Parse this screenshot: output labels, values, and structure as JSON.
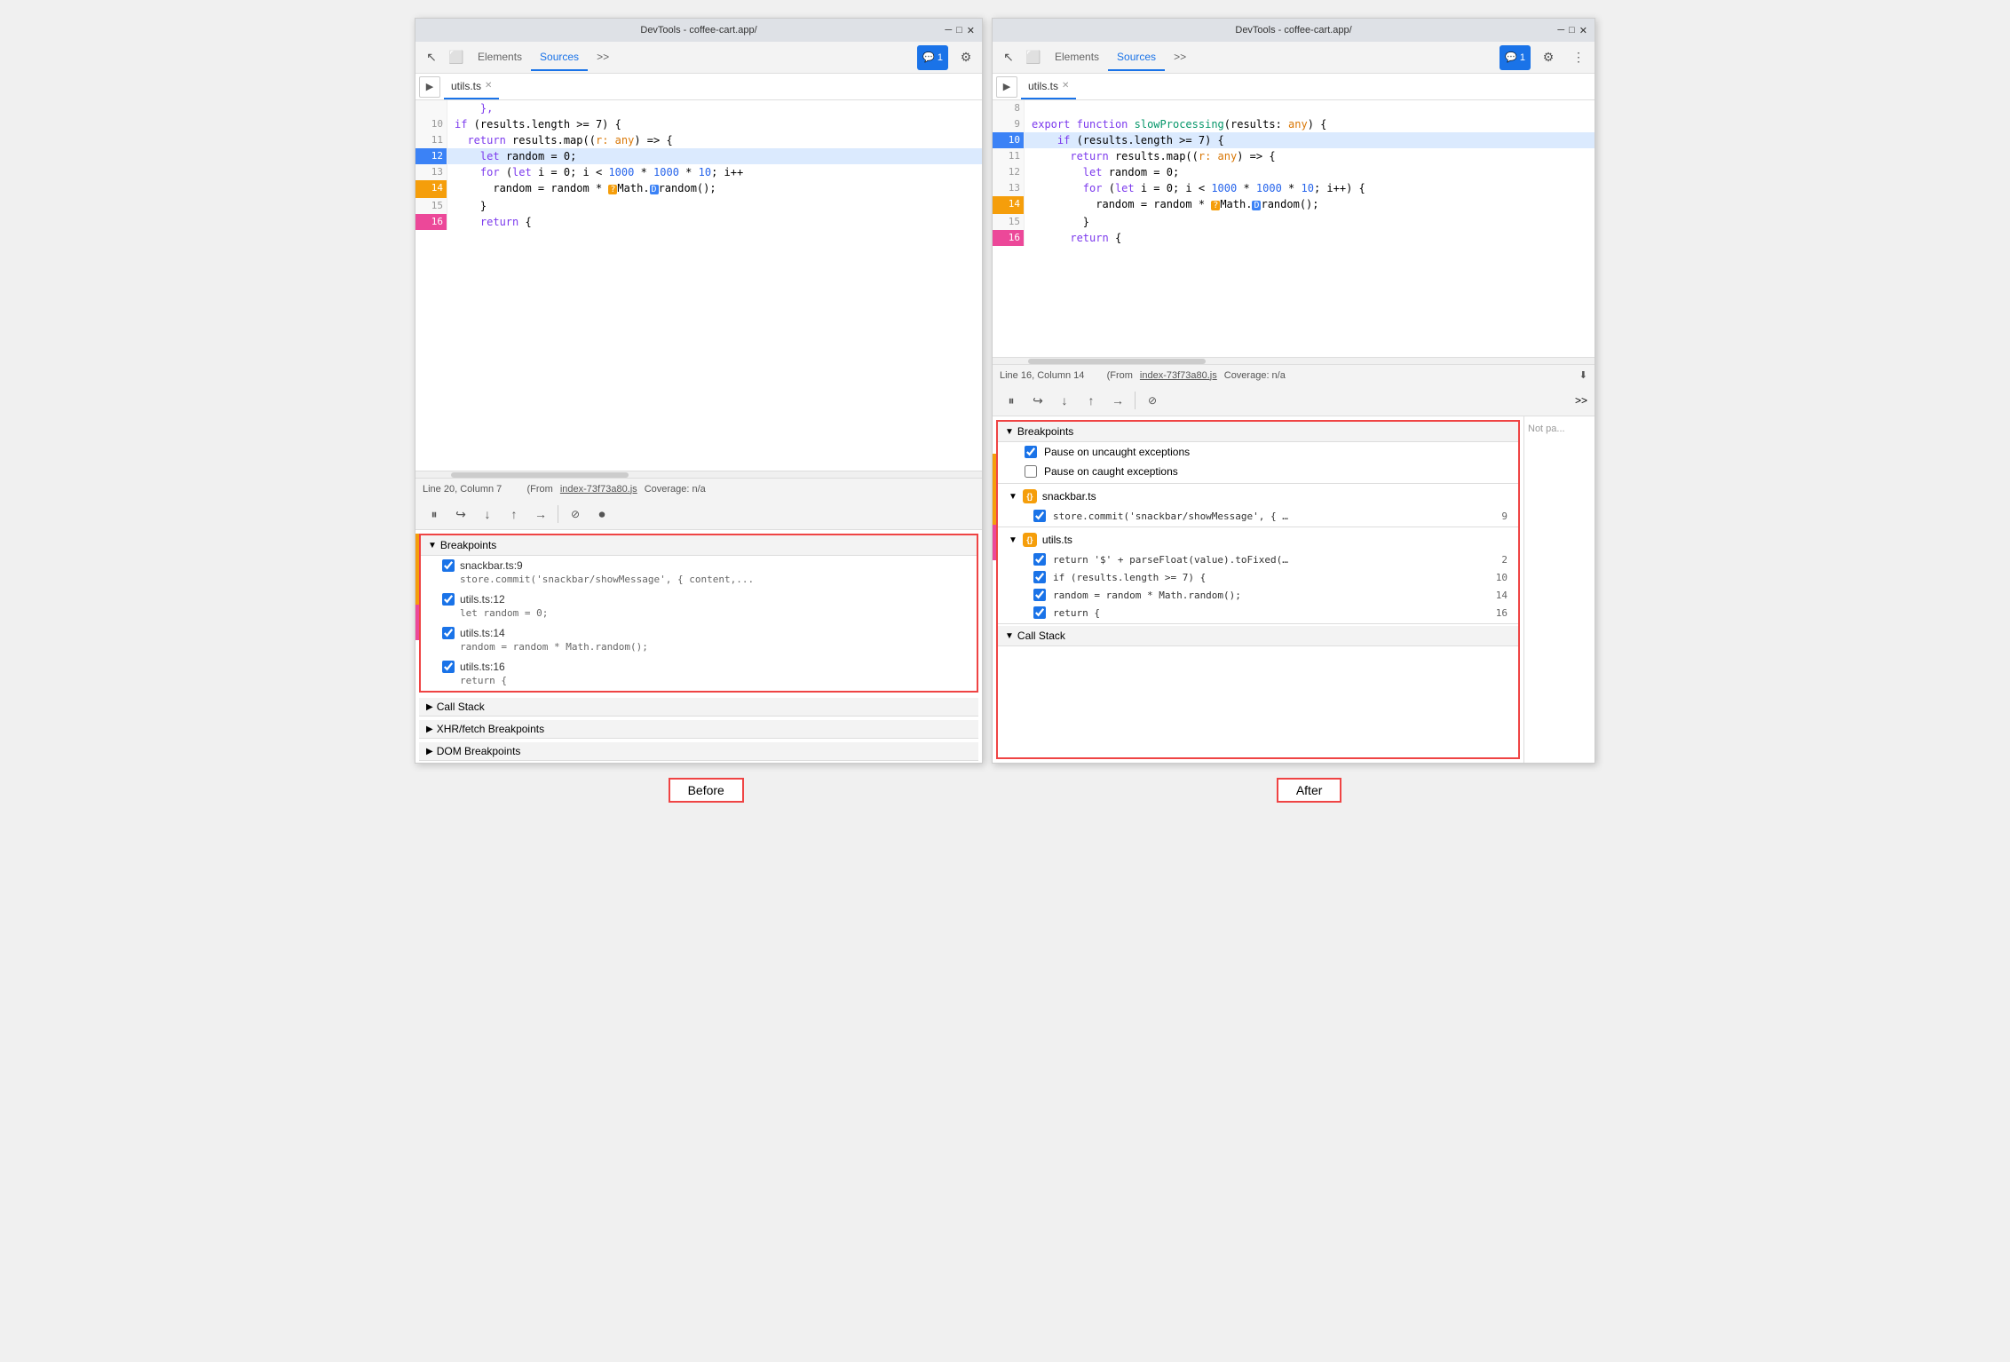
{
  "app": {
    "title": "DevTools - coffee-cart.app/"
  },
  "left_panel": {
    "title": "DevTools - coffee-cart.app/",
    "tabs": [
      {
        "label": "Elements",
        "active": false
      },
      {
        "label": "Sources",
        "active": true
      },
      {
        "label": ">>",
        "active": false
      }
    ],
    "file_tab": "utils.ts",
    "code_lines": [
      {
        "num": "10",
        "content": "    if (results.length >= 7) {",
        "state": "normal"
      },
      {
        "num": "11",
        "content": "      return results.map((r: any) => {",
        "state": "normal"
      },
      {
        "num": "12",
        "content": "        let random = 0;",
        "state": "active"
      },
      {
        "num": "13",
        "content": "        for (let i = 0; i < 1000 * 1000 * 10; i++",
        "state": "normal"
      },
      {
        "num": "14",
        "content": "          random = random * ❓Math.□random();",
        "state": "question"
      },
      {
        "num": "15",
        "content": "        }",
        "state": "normal"
      },
      {
        "num": "16",
        "content": "      return {",
        "state": "pink"
      }
    ],
    "status_bar": {
      "line_col": "Line 20, Column 7",
      "from_text": "(From",
      "from_file": "index-73f73a80.js",
      "coverage": "Coverage: n/a"
    },
    "breakpoints": {
      "title": "Breakpoints",
      "items": [
        {
          "label": "snackbar.ts:9",
          "code": "store.commit('snackbar/showMessage', { content,..."
        },
        {
          "label": "utils.ts:12",
          "code": "let random = 0;"
        },
        {
          "label": "utils.ts:14",
          "code": "random = random * Math.random();"
        },
        {
          "label": "utils.ts:16",
          "code": "return {"
        }
      ]
    },
    "sections": [
      {
        "label": "Call Stack"
      },
      {
        "label": "XHR/fetch Breakpoints"
      },
      {
        "label": "DOM Breakpoints"
      }
    ]
  },
  "right_panel": {
    "title": "DevTools - coffee-cart.app/",
    "tabs": [
      {
        "label": "Elements",
        "active": false
      },
      {
        "label": "Sources",
        "active": true
      },
      {
        "label": ">>",
        "active": false
      }
    ],
    "file_tab": "utils.ts",
    "code_lines": [
      {
        "num": "8",
        "content": "",
        "state": "normal"
      },
      {
        "num": "9",
        "content": "export function slowProcessing(results: any) {",
        "state": "normal"
      },
      {
        "num": "10",
        "content": "    if (results.length >= 7) {",
        "state": "active"
      },
      {
        "num": "11",
        "content": "      return results.map((r: any) => {",
        "state": "normal"
      },
      {
        "num": "12",
        "content": "        let random = 0;",
        "state": "normal"
      },
      {
        "num": "13",
        "content": "        for (let i = 0; i < 1000 * 1000 * 10; i++) {",
        "state": "normal"
      },
      {
        "num": "14",
        "content": "          random = random * ❓Math.□random();",
        "state": "question"
      },
      {
        "num": "15",
        "content": "        }",
        "state": "normal"
      },
      {
        "num": "16",
        "content": "      return {",
        "state": "pink"
      }
    ],
    "status_bar": {
      "line_col": "Line 16, Column 14",
      "from_text": "(From",
      "from_file": "index-73f73a80.js",
      "coverage": "Coverage: n/a"
    },
    "breakpoints": {
      "title": "Breakpoints",
      "pause_uncaught": "Pause on uncaught exceptions",
      "pause_caught": "Pause on caught exceptions",
      "groups": [
        {
          "name": "snackbar.ts",
          "items": [
            {
              "code": "store.commit('snackbar/showMessage', { …",
              "line": "9"
            }
          ]
        },
        {
          "name": "utils.ts",
          "items": [
            {
              "code": "return '$' + parseFloat(value).toFixed(…",
              "line": "2"
            },
            {
              "code": "if (results.length >= 7) {",
              "line": "10"
            },
            {
              "code": "random = random * Math.random();",
              "line": "14"
            },
            {
              "code": "return {",
              "line": "16"
            }
          ]
        }
      ]
    },
    "call_stack_label": "Call Stack",
    "not_paused": "Not pa..."
  },
  "labels": {
    "before": "Before",
    "after": "After"
  }
}
